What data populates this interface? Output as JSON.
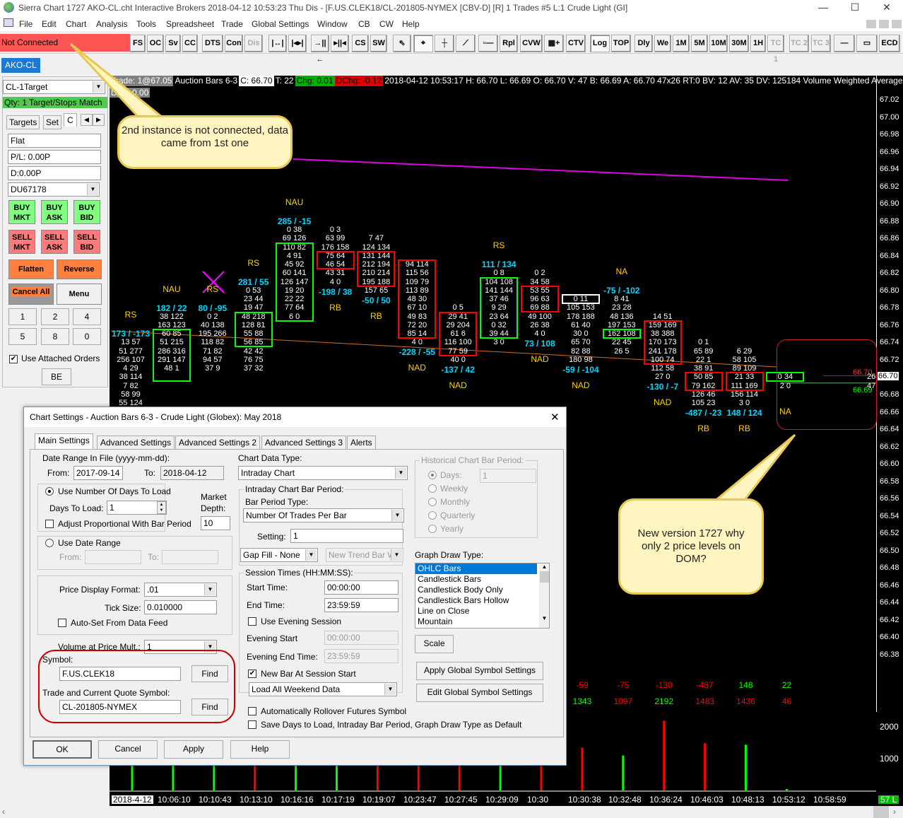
{
  "window": {
    "title": "Sierra Chart 1727 AKO-CL.cht  Interactive Brokers 2018-04-12  10:53:23 Thu  Dis - [F.US.CLEK18/CL-201805-NYMEX [CBV-D] [R]  1 Trades  #5  L:1  Crude Light (GI]",
    "minimize": "—",
    "maximize": "☐",
    "close": "✕"
  },
  "menu": [
    "File",
    "Edit",
    "Chart",
    "Analysis",
    "Tools",
    "Spreadsheet",
    "Trade",
    "Global Settings",
    "Window",
    "CB",
    "CW",
    "Help"
  ],
  "status": {
    "connection": "Not Connected",
    "color": "#ff5555"
  },
  "toolbar": {
    "left": [
      "FS",
      "OC",
      "Sv",
      "CC",
      "DTS",
      "Con",
      "Dis"
    ],
    "mid": [
      "CS",
      "SW"
    ],
    "right": [
      "Rpl",
      "CVW",
      "CTV",
      "Log",
      "TOP",
      "Dly",
      "We",
      "1M",
      "5M",
      "10M",
      "30M",
      "1H",
      "TC 1",
      "TC 2",
      "TC 3",
      "ECD"
    ]
  },
  "chartbook_tab": "AKO-CL",
  "trade_panel": {
    "target_select": "CL-1Target",
    "qty_status": "Qty: 1 Target/Stops Match",
    "tabs": [
      "Targets",
      "Set",
      "C"
    ],
    "position": "Flat",
    "pl": "P/L: 0.00P",
    "daily": "D:0.00P",
    "account": "DU67178",
    "buy": [
      [
        "BUY",
        "MKT"
      ],
      [
        "BUY",
        "ASK"
      ],
      [
        "BUY",
        "BID"
      ]
    ],
    "sell": [
      [
        "SELL",
        "MKT"
      ],
      [
        "SELL",
        "ASK"
      ],
      [
        "SELL",
        "BID"
      ]
    ],
    "flatten": "Flatten",
    "reverse": "Reverse",
    "cancel_all": "Cancel All",
    "menu": "Menu",
    "qty_buttons": [
      "1",
      "2",
      "4",
      "5",
      "8",
      "0"
    ],
    "use_attached": "Use Attached Orders",
    "be": "BE"
  },
  "infobar": {
    "trade": "Trade: 1@67.05",
    "study": "Auction Bars 6-3",
    "close": "C: 66.70",
    "trades": "T: 22",
    "chg": "Chg: 0.01",
    "dchg": "DChg: -0.12",
    "details": "2018-04-12 10:53:17 H: 66.70 L: 66.69 O: 66.70 V: 47 B: 66.69 A: 66.70 47x26 RT:0 BV: 12 AV: 35 DV: 125184 Volume Weighted Average Price",
    "dpl": "DPL: 0.00"
  },
  "chart_data": {
    "type": "footprint",
    "price_axis": {
      "max": 67.02,
      "min": 66.38,
      "step": 0.02
    },
    "current_price": "66.70",
    "bid_label": "66.70",
    "ask_size": "26",
    "bid_size": "47",
    "ask_label": "66.69",
    "vwap": {
      "start": 66.93,
      "end": 66.92
    },
    "bars": [
      {
        "top": 66.74,
        "rows": [
          "13 57",
          "51 277",
          "256 107",
          "4 29",
          "38 114",
          "7 82",
          "58 99",
          "55 124"
        ],
        "box": null,
        "label": "173 / -173",
        "label_pos": "top",
        "label_color": "#00d8ff",
        "note": "RS"
      },
      {
        "top": 66.77,
        "rows": [
          "38 122",
          "163 123",
          "60 85",
          "51 215",
          "286 316",
          "291 147",
          "48 1"
        ],
        "box": [
          66.75,
          66.7,
          "#00ff00"
        ],
        "label": "182 / 22",
        "label_pos": "top",
        "label_color": "#00d8ff",
        "note": "NAU"
      },
      {
        "top": 66.77,
        "rows": [
          "0 2",
          "40 138",
          "195 266",
          "118 82",
          "71 82",
          "94 57",
          "37 9"
        ],
        "box": null,
        "label": "80 / -95",
        "label_pos": "top",
        "label_color": "#00d8ff",
        "note": "RS"
      },
      {
        "top": 66.8,
        "rows": [
          "0 53",
          "23 44",
          "19 47",
          "48 218",
          "128 81",
          "55 88",
          "56 85",
          "42 42",
          "76 75",
          "37 32"
        ],
        "box": [
          66.77,
          66.74,
          "#00ff00"
        ],
        "label": "281 / 55",
        "label_pos": "top",
        "label_color": "#00d8ff",
        "note": "RS"
      },
      {
        "top": 66.87,
        "rows": [
          "0 38",
          "69 126",
          "110 82",
          "4 91",
          "45 92",
          "60 141",
          "126 147",
          "19 20",
          "22 22",
          "77 64",
          "6 0"
        ],
        "box": [
          66.85,
          66.77,
          "#00ff00"
        ],
        "label": "285 / -15",
        "label_pos": "top",
        "label_color": "#00d8ff",
        "note": "NAU"
      },
      {
        "top": 66.87,
        "rows": [
          "0 3",
          "63 99",
          "176 158",
          "75 64",
          "46 54",
          "43 31",
          "4 0"
        ],
        "box": [
          66.84,
          66.83,
          "#ff0000"
        ],
        "label": "-198 / 38",
        "label_pos": "bottom",
        "label_color": "#00d8ff",
        "note": "RB"
      },
      {
        "top": 66.86,
        "rows": [
          "7 47",
          "124 134",
          "131 144",
          "212 194",
          "210 214",
          "195 188",
          "157 65"
        ],
        "box": [
          66.84,
          66.81,
          "#ff0000"
        ],
        "label": "-50 / 50",
        "label_pos": "bottom",
        "label_color": "#00d8ff",
        "note": "RB"
      },
      {
        "top": 66.83,
        "rows": [
          "94 114",
          "115 56",
          "109 79",
          "113 89",
          "48 30",
          "67 10",
          "49 83",
          "72 20",
          "85 14",
          "4 0"
        ],
        "box": [
          66.83,
          66.75,
          "#ff0000"
        ],
        "label": "-228 / -55",
        "label_pos": "bottom",
        "label_color": "#00d8ff",
        "note": "NAD"
      },
      {
        "top": 66.78,
        "rows": [
          "0 5",
          "29 41",
          "29 204",
          "61 6",
          "116 100",
          "77 59",
          "40 0"
        ],
        "box": [
          66.77,
          66.73,
          "#ff0000"
        ],
        "label": "-137 / 42",
        "label_pos": "bottom",
        "label_color": "#00d8ff",
        "note": "NAD"
      },
      {
        "top": 66.82,
        "rows": [
          "0 8",
          "104 108",
          "141 144",
          "37 46",
          "9 29",
          "23 64",
          "0 32",
          "39 44",
          "3 0"
        ],
        "box": [
          66.81,
          66.75,
          "#00ff00"
        ],
        "label": "111 / 134",
        "label_pos": "top",
        "label_color": "#00d8ff",
        "note": "RS"
      },
      {
        "top": 66.82,
        "rows": [
          "0 2",
          "34 58",
          "53 55",
          "96 63",
          "69 88",
          "49 100",
          "26 38",
          "4 0"
        ],
        "box": [
          66.8,
          66.78,
          "#ff0000"
        ],
        "label": "73 / 108",
        "label_pos": "bottom",
        "label_color": "#00d8ff",
        "note": "NAD"
      },
      {
        "top": 66.79,
        "rows": [
          "0 11",
          "105 153",
          "178 188",
          "61 40",
          "30 0",
          "65 70",
          "82 88",
          "180 98"
        ],
        "box": [
          66.79,
          66.79,
          "#ffffff"
        ],
        "label": "-59 / -104",
        "label_pos": "bottom",
        "label_color": "#00d8ff",
        "note": "NAD"
      },
      {
        "top": 66.79,
        "rows": [
          "8 41",
          "23 28",
          "48 136",
          "197 153",
          "162 108",
          "22 45",
          "26 5"
        ],
        "box": [
          66.75,
          66.75,
          "#00ff00"
        ],
        "label": "-75 / -102",
        "label_pos": "top",
        "label_color": "#00d8ff",
        "note": "NA"
      },
      {
        "top": 66.77,
        "rows": [
          "14 51",
          "159 169",
          "38 388",
          "170 173",
          "241 178",
          "100 74",
          "112 58",
          "27 0"
        ],
        "box": [
          66.76,
          66.72,
          "#ff0000"
        ],
        "label": "-130 / -7",
        "label_pos": "bottom",
        "label_color": "#00d8ff",
        "note": "NAD"
      },
      {
        "top": 66.74,
        "rows": [
          "0 1",
          "65 89",
          "22 1",
          "38 91",
          "50 85",
          "79 162",
          "126 46",
          "105 23"
        ],
        "box": [
          66.7,
          66.69,
          "#ff0000"
        ],
        "label": "-487 / -23",
        "label_pos": "bottom",
        "label_color": "#00d8ff",
        "note": "RB"
      },
      {
        "top": 66.73,
        "rows": [
          "6 29",
          "58 105",
          "89 109",
          "21 33",
          "111 169",
          "156 114",
          "3 0"
        ],
        "box": [
          66.7,
          66.69,
          "#ff0000"
        ],
        "label": "148 / 124",
        "label_pos": "bottom",
        "label_color": "#00d8ff",
        "note": "RB"
      },
      {
        "top": 66.7,
        "rows": [
          "0 34",
          "2 0"
        ],
        "box": [
          66.7,
          66.7,
          "#00ff00"
        ],
        "label": "",
        "label_pos": "bottom",
        "label_color": "#00d8ff",
        "note": "NA"
      }
    ],
    "volume_axis": {
      "ticks": [
        "2000",
        "1000"
      ],
      "max": 2500
    },
    "volume": [
      800,
      800,
      800,
      800,
      800,
      800,
      800,
      800,
      800,
      800,
      800,
      1343,
      1097,
      2192,
      1483,
      1436,
      46
    ],
    "volume_colors": [
      "#00ff00",
      "#00ff00",
      "#00ff00",
      "#ff0000",
      "#00ff00",
      "#00ff00",
      "#ff0000",
      "#ff0000",
      "#ff0000",
      "#00ff00",
      "#ff0000",
      "#ff0000",
      "#00ff00",
      "#ff0000",
      "#ff0000",
      "#00ff00",
      "#00ff00"
    ],
    "delta_row": [
      {
        "v": "-59",
        "c": "#ff0000"
      },
      {
        "v": "-75",
        "c": "#ff0000"
      },
      {
        "v": "-130",
        "c": "#ff0000"
      },
      {
        "v": "-487",
        "c": "#ff0000"
      },
      {
        "v": "148",
        "c": "#00ff00"
      },
      {
        "v": "22",
        "c": "#00ff00"
      }
    ],
    "volume_row": [
      {
        "v": "1343",
        "c": "#00ff00"
      },
      {
        "v": "1097",
        "c": "#ff0000"
      },
      {
        "v": "2192",
        "c": "#00ff00"
      },
      {
        "v": "1483",
        "c": "#ff0000"
      },
      {
        "v": "1436",
        "c": "#ff0000"
      },
      {
        "v": "46",
        "c": "#ff0000"
      }
    ],
    "time_labels": [
      "2018-4-12",
      "10:06:10",
      "10:10:43",
      "10:13:10",
      "10:16:16",
      "10:17:19",
      "10:19:07",
      "10:23:47",
      "10:27:45",
      "10:29:09",
      "10:30",
      "10:30:38",
      "10:32:48",
      "10:36:24",
      "10:46:03",
      "10:48:13",
      "10:53:12",
      "10:58:59"
    ],
    "bars_badge": "57 L"
  },
  "callouts": {
    "first": "2nd instance is not connected, data came from 1st one",
    "second": "New version 1727 why only 2 price levels on DOM?"
  },
  "dialog": {
    "title": "Chart Settings - Auction Bars 6-3 - Crude Light (Globex): May 2018",
    "close": "✕",
    "tabs": [
      "Main Settings",
      "Advanced Settings",
      "Advanced Settings 2",
      "Advanced Settings 3",
      "Alerts"
    ],
    "date_range_label": "Date Range In File (yyyy-mm-dd):",
    "from_label": "From:",
    "from": "2017-09-14",
    "to_label": "To:",
    "to": "2018-04-12",
    "use_days": "Use Number Of Days To Load",
    "days_label": "Days To Load:",
    "days": "1",
    "adjust": "Adjust Proportional With Bar Period",
    "market_depth_label1": "Market",
    "market_depth_label2": "Depth:",
    "market_depth": "10",
    "use_date_range": "Use Date Range",
    "dr_from": "From:",
    "dr_to": "To:",
    "price_format_label": "Price Display Format:",
    "price_format": ".01",
    "tick_label": "Tick Size:",
    "tick": "0.010000",
    "autoset": "Auto-Set From Data Feed",
    "vap_label": "Volume at Price Mult.:",
    "vap": "1",
    "symbol_label": "Symbol:",
    "symbol": "F.US.CLEK18",
    "find": "Find",
    "quote_label": "Trade and Current Quote Symbol:",
    "quote_symbol": "CL-201805-NYMEX",
    "data_type_label": "Chart Data Type:",
    "data_type": "Intraday Chart",
    "intraday_group": "Intraday Chart Bar Period:",
    "bar_type_label": "Bar Period Type:",
    "bar_type": "Number Of Trades Per Bar",
    "setting_label": "Setting:",
    "setting": "1",
    "gap_fill": "Gap Fill - None",
    "new_trend": "New Trend Bar W",
    "session_group": "Session Times (HH:MM:SS):",
    "start_label": "Start Time:",
    "start": "00:00:00",
    "end_label": "End Time:",
    "end": "23:59:59",
    "use_evening": "Use Evening Session",
    "ev_start_label": "Evening Start",
    "ev_start": "00:00:00",
    "ev_end_label": "Evening End Time:",
    "ev_end": "23:59:59",
    "new_bar": "New Bar At Session Start",
    "weekend": "Load All Weekend Data",
    "rollover": "Automatically Rollover Futures Symbol",
    "save_default": "Save Days to Load, Intraday Bar Period, Graph Draw Type as Default",
    "hist_group": "Historical Chart Bar Period:",
    "hist_days": "Days:",
    "hist_days_val": "1",
    "hist_options": [
      "Weekly",
      "Monthly",
      "Quarterly",
      "Yearly"
    ],
    "draw_type_label": "Graph Draw Type:",
    "draw_types": [
      "OHLC Bars",
      "Candlestick Bars",
      "Candlestick Body Only",
      "Candlestick Bars Hollow",
      "Line on Close",
      "Mountain"
    ],
    "scale": "Scale",
    "apply_global": "Apply Global Symbol Settings",
    "edit_global": "Edit Global Symbol Settings",
    "ok": "OK",
    "cancel": "Cancel",
    "apply": "Apply",
    "help": "Help"
  }
}
